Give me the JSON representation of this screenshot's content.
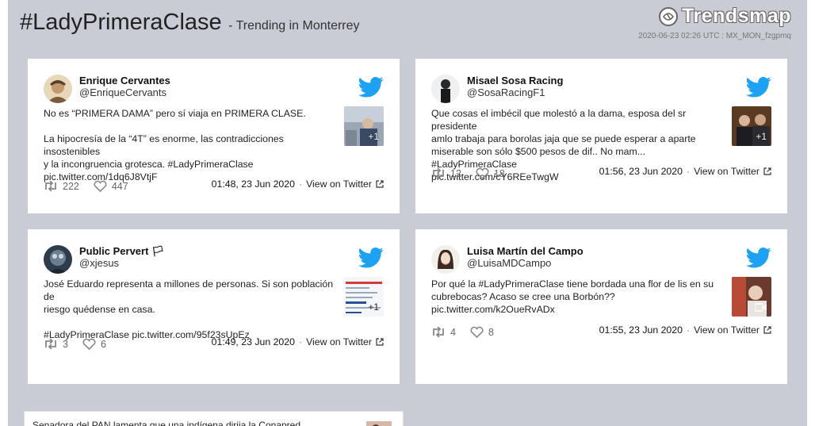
{
  "header": {
    "hashtag": "#LadyPrimeraClase",
    "subtitle": "- Trending in Monterrey",
    "brand": "Trendsmap",
    "stamp": "2020-06-23 02:26 UTC : MX_MON_fzgpmq"
  },
  "tweets": [
    {
      "name": "Enrique Cervantes",
      "handle": "@EnriqueCervants",
      "lines": [
        "No es “PRIMERA DAMA” pero sí viaja en PRIMERA CLASE.",
        "",
        "La hipocresía de la “4T” es enorme, las contradicciones insostenibles",
        "y la incongruencia grotesca. #LadyPrimeraClase",
        "pic.twitter.com/1dq6J8VtjF"
      ],
      "thumb_count": "+1",
      "retweets": "222",
      "likes": "447",
      "time": "01:48, 23 Jun 2020",
      "view": "View on Twitter"
    },
    {
      "name": "Misael Sosa Racing",
      "handle": "@SosaRacingF1",
      "lines": [
        "Que cosas el imbécil que molestó a la dama, esposa del sr presidente",
        "amlo trabaja para borolas jaja que se puede esperar a aparte",
        "miserable son sólo $500 pesos de dif.. No mam... #LadyPrimeraClase",
        "pic.twitter.com/cY6REeTwgW"
      ],
      "thumb_count": "+1",
      "retweets": "12",
      "likes": "18",
      "time": "01:56, 23 Jun 2020",
      "view": "View on Twitter"
    },
    {
      "name": "Public Pervert 🏳",
      "handle": "@xjesus",
      "lines": [
        "José Eduardo representa a millones de personas. Si son población de",
        "riesgo quédense en casa.",
        "",
        "#LadyPrimeraClase pic.twitter.com/95f23sUpEz"
      ],
      "thumb_count": "+1",
      "retweets": "3",
      "likes": "6",
      "time": "01:49, 23 Jun 2020",
      "view": "View on Twitter"
    },
    {
      "name": "Luisa Martín del Campo",
      "handle": "@LuisaMDCampo",
      "lines": [
        "Por qué la #LadyPrimeraClase tiene bordada una flor de lis en su",
        "cubrebocas? Acaso se cree una Borbón??",
        "pic.twitter.com/k2OueRvADx"
      ],
      "thumb_count": "",
      "retweets": "4",
      "likes": "8",
      "time": "01:55, 23 Jun 2020",
      "view": "View on Twitter"
    }
  ],
  "bottom": {
    "text": "Senadora del PAN lamenta que una indígena dirija la Conapred"
  },
  "colors": {
    "background": "#c9ccd5",
    "card": "#ffffff",
    "twitter_blue": "#1da1f2"
  },
  "icons": [
    "twitter-bird-icon",
    "retweet-icon",
    "heart-icon",
    "external-link-icon",
    "video-camera-icon",
    "trendsmap-logo-icon"
  ]
}
